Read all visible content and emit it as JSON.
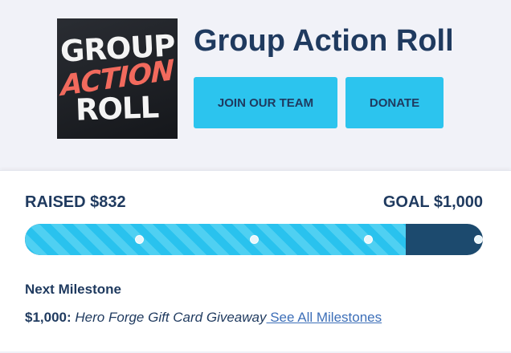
{
  "header": {
    "logo": {
      "line1": "GROUP",
      "line2": "ACTION",
      "line3": "ROLL"
    },
    "title": "Group Action Roll",
    "join_label": "JOIN OUR TEAM",
    "donate_label": "DONATE"
  },
  "progress": {
    "raised_label": "RAISED $832",
    "goal_label": "GOAL $1,000",
    "raised_value": 832,
    "goal_value": 1000,
    "milestone_marks": [
      0.25,
      0.5,
      0.75,
      1.0
    ]
  },
  "milestone": {
    "heading": "Next Milestone",
    "amount": "$1,000:",
    "name": "Hero Forge Gift Card Giveaway",
    "link": "See All Milestones"
  },
  "colors": {
    "accent": "#2cc4ee",
    "navy": "#1f3a5f",
    "bar_track": "#1c4a6e"
  }
}
